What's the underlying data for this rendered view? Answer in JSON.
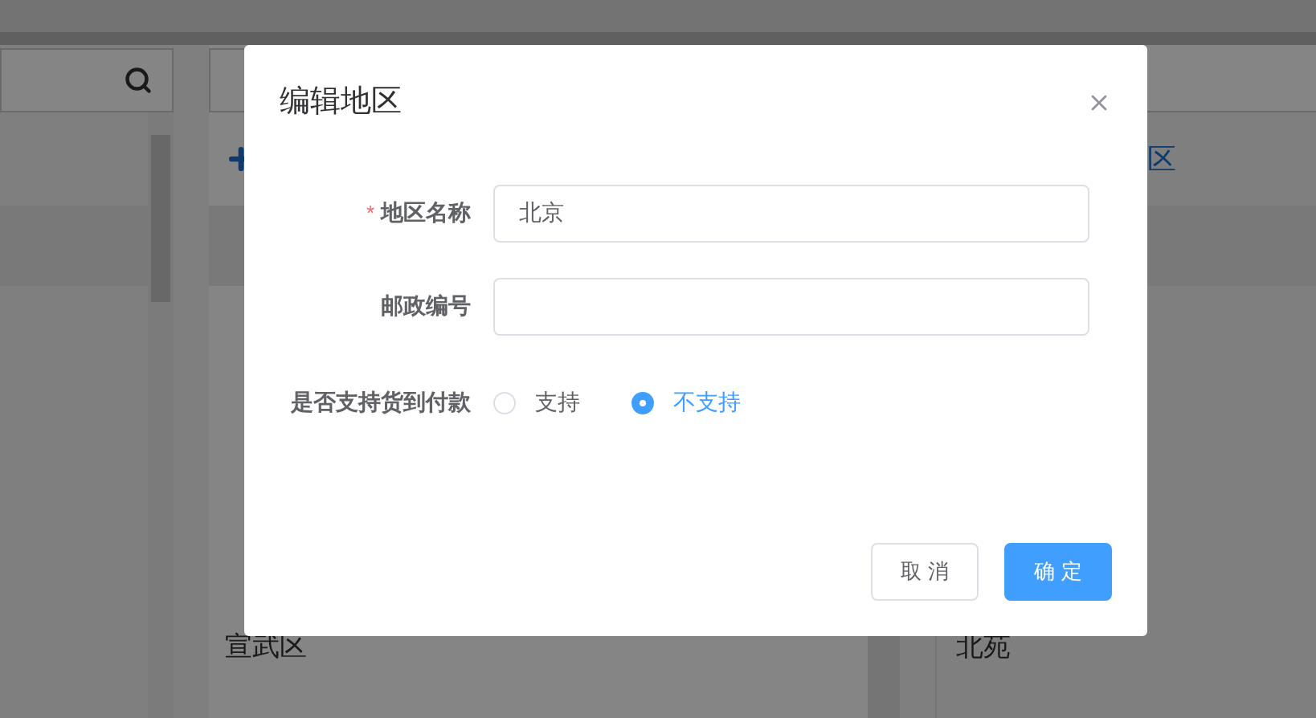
{
  "background": {
    "middle_rows": [
      "宣武区"
    ],
    "right_link": "区",
    "right_rows": [
      "北苑"
    ]
  },
  "dialog": {
    "title": "编辑地区",
    "fields": [
      {
        "required_mark": "*",
        "label": "地区名称",
        "value": "北京"
      },
      {
        "label": "邮政编号"
      }
    ],
    "radio_group": {
      "label": "是否支持货到付款",
      "options": [
        {
          "label": "支持",
          "selected": false
        },
        {
          "label": "不支持",
          "selected": true
        }
      ]
    },
    "buttons": [
      {
        "label": "取 消",
        "kind": "default"
      },
      {
        "label": "确 定",
        "kind": "primary"
      }
    ]
  }
}
